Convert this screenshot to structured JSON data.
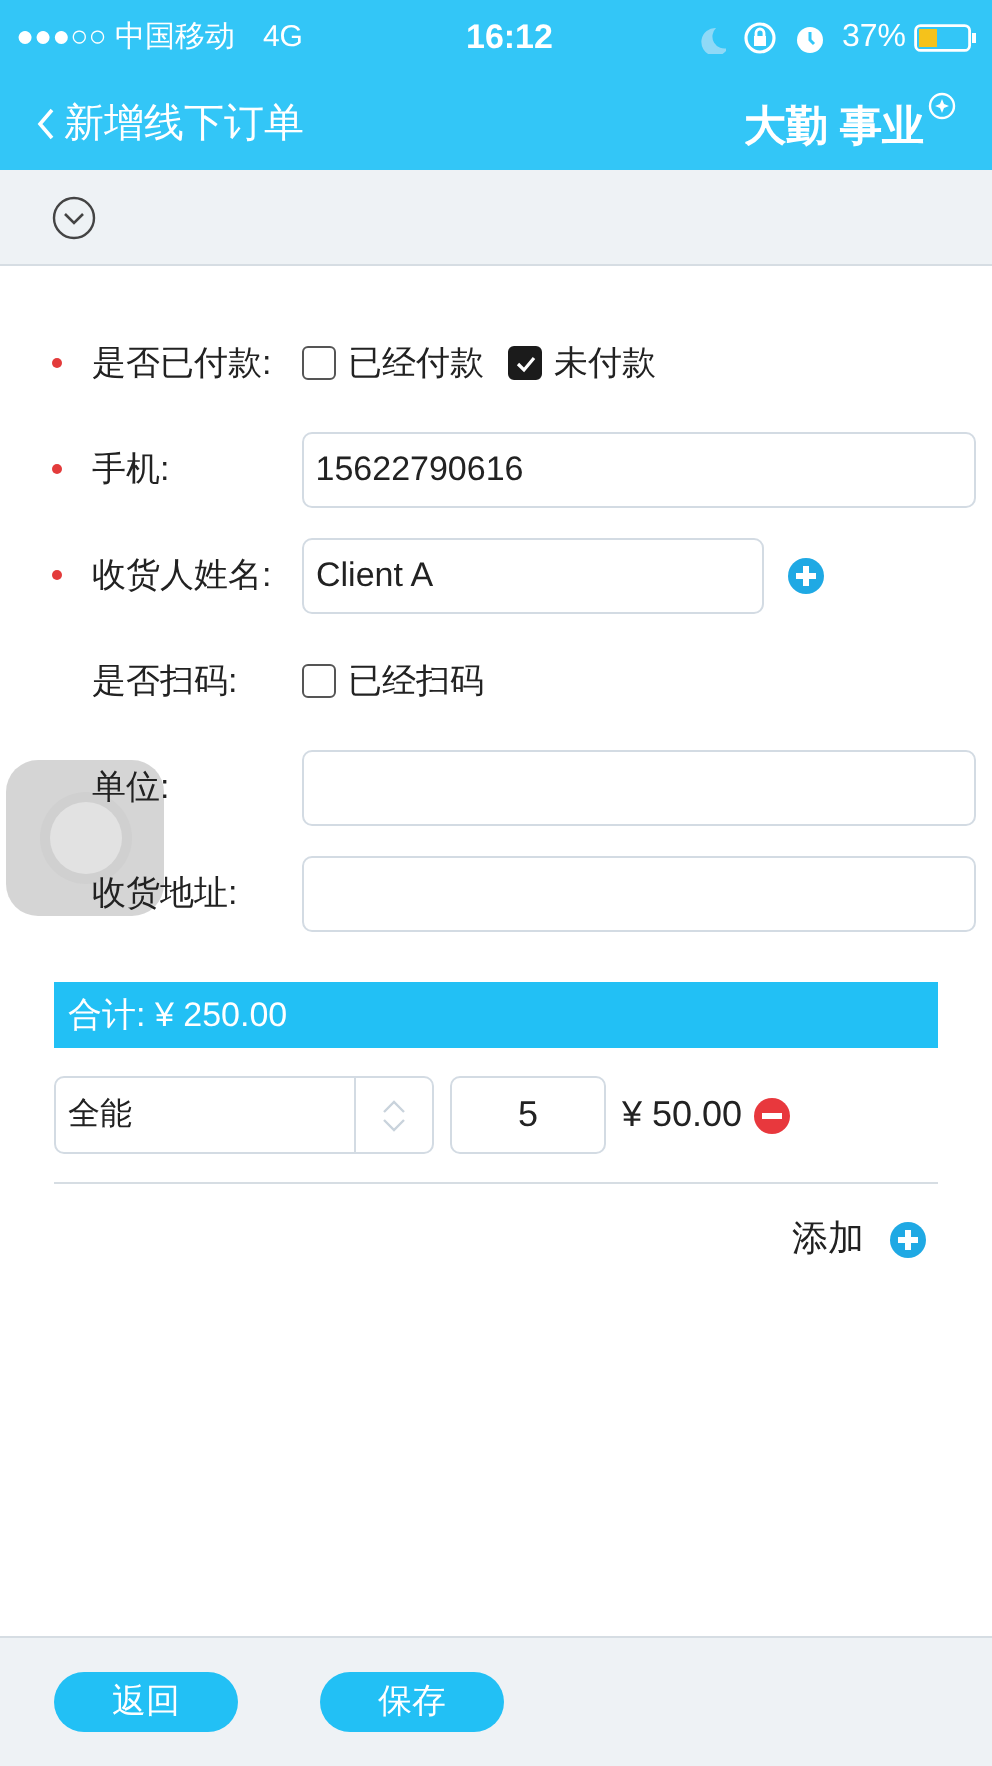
{
  "status_bar": {
    "carrier": "●●●○○ 中国移动",
    "network": "4G",
    "time": "16:12",
    "battery": "37%"
  },
  "header": {
    "title": "新增线下订单",
    "logo": "大勤 事业"
  },
  "form": [
    {
      "kind": "choice",
      "label": "是否已付款:",
      "required": true,
      "options": [
        {
          "label": "已经付款",
          "checked": false
        },
        {
          "label": "未付款",
          "checked": true
        }
      ]
    },
    {
      "kind": "text",
      "label": "手机:",
      "required": true,
      "value": "15622790616"
    },
    {
      "kind": "text",
      "label": "收货人姓名:",
      "required": true,
      "value": "Client A",
      "add_button": true
    },
    {
      "kind": "choice",
      "label": "是否扫码:",
      "required": false,
      "options": [
        {
          "label": "已经扫码",
          "checked": false
        }
      ]
    },
    {
      "kind": "text",
      "label": "单位:",
      "required": false
    },
    {
      "kind": "text",
      "label": "收货地址:",
      "required": false
    }
  ],
  "total": "合计: ¥ 250.00",
  "items": [
    {
      "product": "全能",
      "quantity": "5",
      "price": "¥ 50.00"
    }
  ],
  "add_label": "添加",
  "buttons": [
    "返回",
    "保存"
  ]
}
